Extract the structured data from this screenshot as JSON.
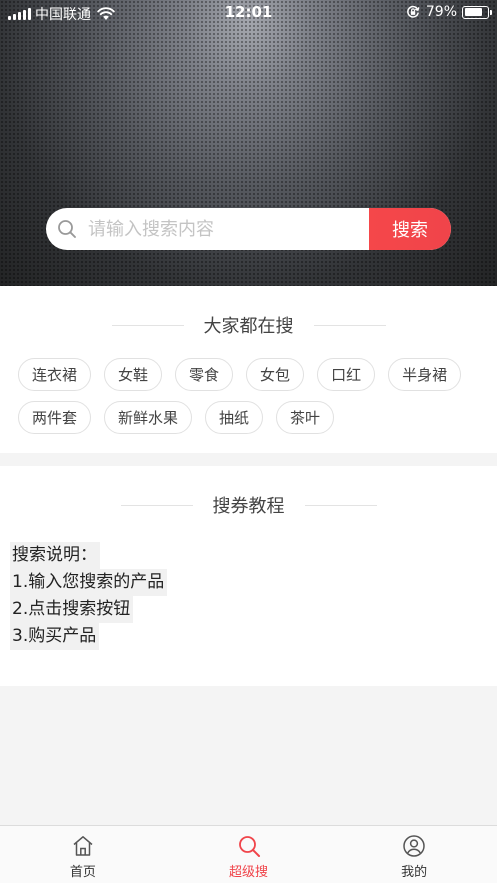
{
  "status_bar": {
    "carrier": "中国联通",
    "time": "12:01",
    "battery_percent": "79%",
    "battery_level": 0.79,
    "icons": [
      "signal-icon",
      "wifi-icon",
      "orientation-lock-icon",
      "battery-icon"
    ]
  },
  "search": {
    "placeholder": "请输入搜索内容",
    "value": "",
    "button_label": "搜索",
    "icon": "search-icon"
  },
  "popular": {
    "title": "大家都在搜",
    "tags": [
      "连衣裙",
      "女鞋",
      "零食",
      "女包",
      "口红",
      "半身裙",
      "两件套",
      "新鲜水果",
      "抽纸",
      "茶叶"
    ]
  },
  "tutorial": {
    "title": "搜券教程",
    "lines": [
      "搜索说明：",
      "1.输入您搜索的产品",
      "2.点击搜索按钮",
      "3.购买产品"
    ]
  },
  "bottom_nav": {
    "items": [
      {
        "label": "首页",
        "icon": "home-icon",
        "active": false
      },
      {
        "label": "超级搜",
        "icon": "search-icon",
        "active": true
      },
      {
        "label": "我的",
        "icon": "profile-icon",
        "active": false
      }
    ]
  },
  "colors": {
    "accent": "#f0444a",
    "text": "#333333",
    "tag_border": "#e1e1e1",
    "page_background": "#f4f4f4"
  }
}
